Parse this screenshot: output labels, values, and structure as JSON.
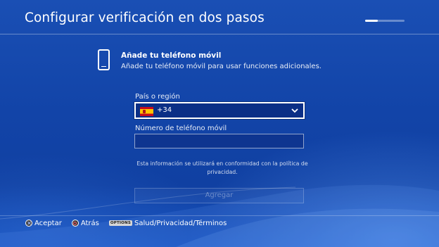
{
  "header": {
    "title": "Configurar verificación en dos pasos",
    "progress": 0.33
  },
  "section": {
    "icon": "phone-icon",
    "title": "Añade tu teléfono móvil",
    "description": "Añade tu teléfono móvil para usar funciones adicionales."
  },
  "form": {
    "country_label": "País o región",
    "country_flag": "spain-flag-icon",
    "country_value": "+34",
    "phone_label": "Número de teléfono móvil",
    "phone_value": "",
    "privacy_note": "Esta información se utilizará en conformidad con la política de privacidad.",
    "add_button": "Agregar"
  },
  "footer": {
    "accept": "Aceptar",
    "back": "Atrás",
    "options_glyph": "OPTIONS",
    "options_label": "Salud/Privacidad/Términos"
  },
  "colors": {
    "background": "#1244a8",
    "field": "#0b2f86",
    "text": "#ffffff"
  }
}
